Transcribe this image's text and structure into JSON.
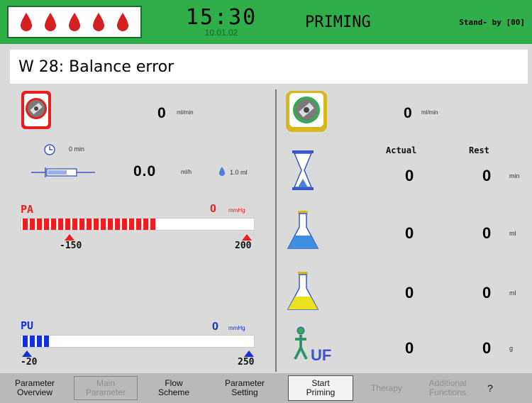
{
  "header": {
    "time": "15:30",
    "date": "10.01.02",
    "mode": "PRIMING",
    "standby": "Stand- by",
    "standby_code": "[00]",
    "drop_count": 5,
    "colors": {
      "bar": "#2fae4a",
      "drop": "#d42020"
    }
  },
  "message": "W 28: Balance error",
  "blood_pump": {
    "value": "0",
    "unit": "ml/min",
    "icon": "blood-pump-icon"
  },
  "heparin": {
    "time_value": "0 min",
    "rate_value": "0.0",
    "rate_unit": "ml/h",
    "bolus": "1.0 ml",
    "icons": [
      "clock-icon",
      "syringe-icon",
      "drop-icon"
    ]
  },
  "pa": {
    "label": "PA",
    "value": "0",
    "unit": "mmHg",
    "lower": "-150",
    "upper": "200",
    "color": "#ee1c1c",
    "filled_segments": 19
  },
  "pv": {
    "label": "PU",
    "value": "0",
    "unit": "mmHg",
    "lower": "-20",
    "upper": "250",
    "color": "#1530d8",
    "filled_segments": 4
  },
  "uf_pump": {
    "value": "0",
    "unit": "ml/min",
    "icon": "uf-pump-icon"
  },
  "table": {
    "headers": {
      "actual": "Actual",
      "rest": "Rest"
    },
    "rows": [
      {
        "icon": "hourglass-icon",
        "actual": "0",
        "rest": "0",
        "unit": "min"
      },
      {
        "icon": "blue-flask-icon",
        "actual": "0",
        "rest": "0",
        "unit": "ml"
      },
      {
        "icon": "yellow-flask-icon",
        "actual": "0",
        "rest": "0",
        "unit": "ml"
      },
      {
        "icon": "uf-person-icon",
        "actual": "0",
        "rest": "0",
        "unit": "g"
      }
    ]
  },
  "bottom": {
    "param_overview": "Parameter\nOverview",
    "main_parameter": "Main\nParameter",
    "flow_scheme": "Flow\nScheme",
    "param_setting": "Parameter\nSetting",
    "start_priming": "Start\nPriming",
    "therapy": "Therapy",
    "additional": "Additional\nFunctions",
    "help": "?"
  }
}
